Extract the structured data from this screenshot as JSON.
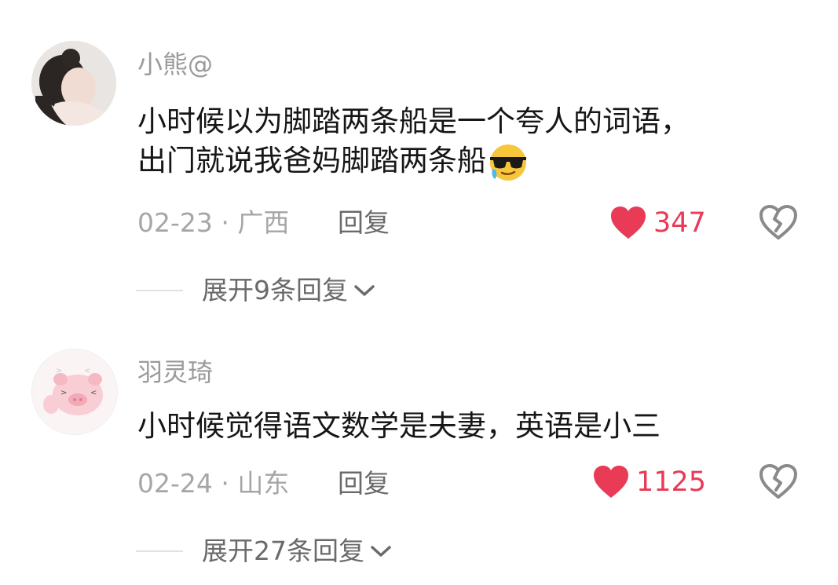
{
  "comments": [
    {
      "username": "小熊@",
      "lines": [
        "小时候以为脚踏两条船是一个夸人的词语，",
        "出门就说我爸妈脚踏两条船"
      ],
      "emoji": "cool-sunglasses-emoji",
      "date_location": "02-23 · 广西",
      "reply_label": "回复",
      "likes": "347",
      "expand_label": "展开9条回复"
    },
    {
      "username": "羽灵琦",
      "lines": [
        "小时候觉得语文数学是夫妻，英语是小三"
      ],
      "date_location": "02-24 · 山东",
      "reply_label": "回复",
      "likes": "1125",
      "expand_label": "展开27条回复"
    }
  ],
  "colors": {
    "like_red": "#e93a56",
    "muted_text": "#9a9a9a",
    "body_text": "#161616"
  },
  "icons": [
    "heart-icon",
    "broken-heart-icon",
    "chevron-down-icon"
  ]
}
